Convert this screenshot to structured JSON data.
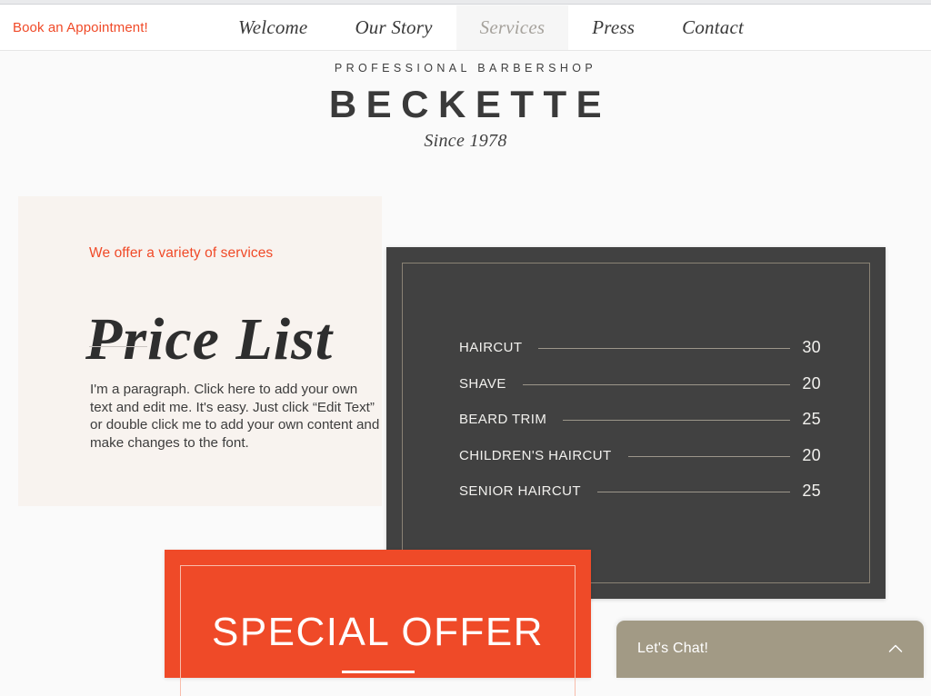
{
  "nav": {
    "cta_label": "Book an Appointment!",
    "items": [
      {
        "label": "Welcome",
        "active": false
      },
      {
        "label": "Our Story",
        "active": false
      },
      {
        "label": "Services",
        "active": true
      },
      {
        "label": "Press",
        "active": false
      },
      {
        "label": "Contact",
        "active": false
      }
    ]
  },
  "logo": {
    "kicker": "PROFESSIONAL BARBERSHOP",
    "name": "BECKETTE",
    "since": "Since 1978"
  },
  "intro": {
    "eyebrow": "We offer a variety of services",
    "title": "Price List",
    "paragraph": "I'm a paragraph. Click here to add your own text and edit me. It's easy. Just click “Edit Text” or double click me to add your own content and make changes to the font."
  },
  "price_list": {
    "rows": [
      {
        "service": "HAIRCUT",
        "price": "30"
      },
      {
        "service": "SHAVE",
        "price": "20"
      },
      {
        "service": "BEARD TRIM",
        "price": "25"
      },
      {
        "service": "CHILDREN'S HAIRCUT",
        "price": "20"
      },
      {
        "service": "SENIOR HAIRCUT",
        "price": "25"
      }
    ]
  },
  "offer": {
    "title": "SPECIAL OFFER"
  },
  "chat": {
    "label": "Let's Chat!",
    "toggle_icon": "chevron-up-icon"
  },
  "colors": {
    "accent_orange": "#ef4a28",
    "panel_dark": "#414141",
    "panel_border": "#8a8274",
    "card_beige": "#f8f3ef",
    "chat_khaki": "#a29a85",
    "nav_active_text": "#a6a29c",
    "nav_active_bg": "#f6f6f6"
  }
}
